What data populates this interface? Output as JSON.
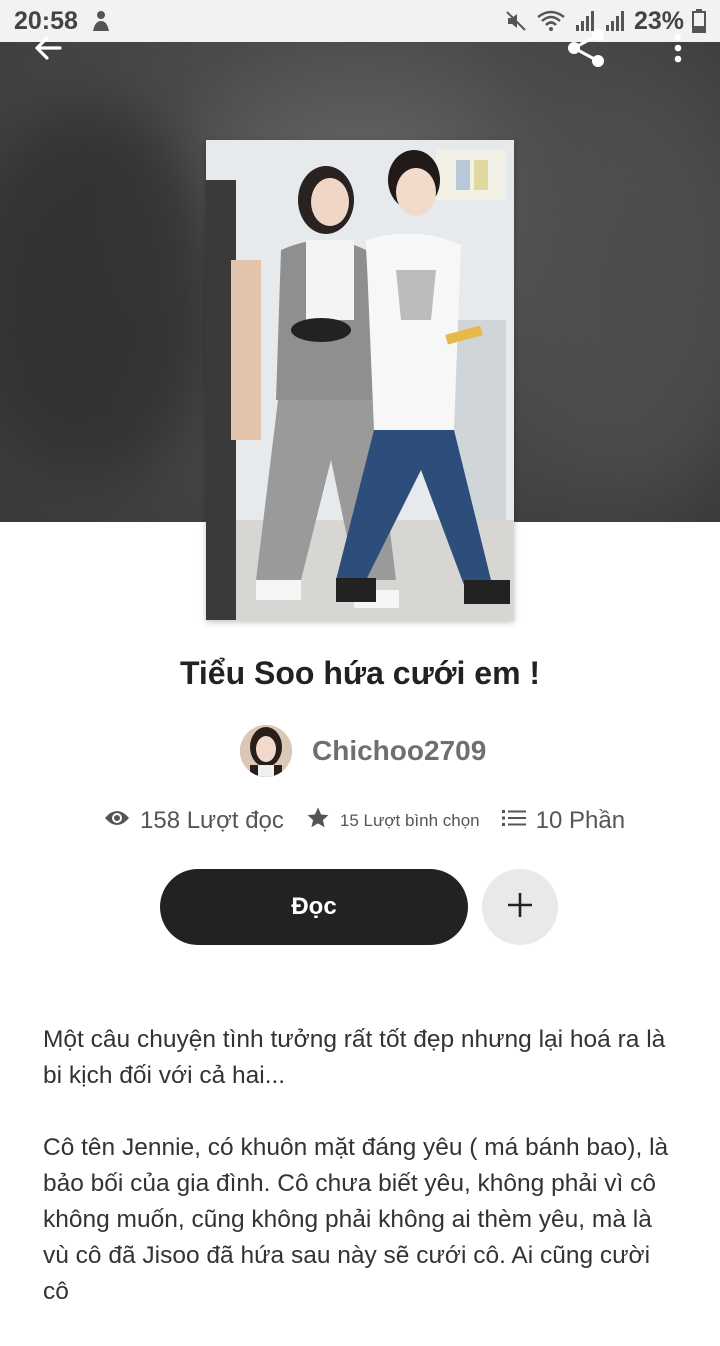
{
  "status_bar": {
    "time": "20:58",
    "battery": "23%"
  },
  "icons": {
    "back": "arrow-left-icon",
    "share": "share-icon",
    "more": "more-vertical-icon",
    "reads": "eye-icon",
    "votes": "star-icon",
    "parts": "list-icon",
    "add": "plus-icon"
  },
  "story": {
    "title": "Tiểu Soo hứa cưới em !",
    "author": "Chichoo2709",
    "reads": "158 Lượt đọc",
    "votes": "15 Lượt bình chọn",
    "parts": "10 Phần",
    "read_button": "Đọc",
    "description": [
      "Một câu chuyện tình tưởng rất tốt đẹp nhưng lại hoá ra là bi kịch đối với cả hai...",
      "Cô tên Jennie, có khuôn mặt đáng yêu ( má bánh bao), là bảo bối của gia đình. Cô chưa biết yêu, không phải vì cô không muốn, cũng không phải không ai thèm yêu, mà là vù cô đã Jisoo đã hứa sau này sẽ cưới cô. Ai cũng cười cô"
    ]
  },
  "colors": {
    "accent_dark": "#222222",
    "add_button_bg": "#e9e9e9",
    "hero_bg": "#4a4a4a"
  }
}
